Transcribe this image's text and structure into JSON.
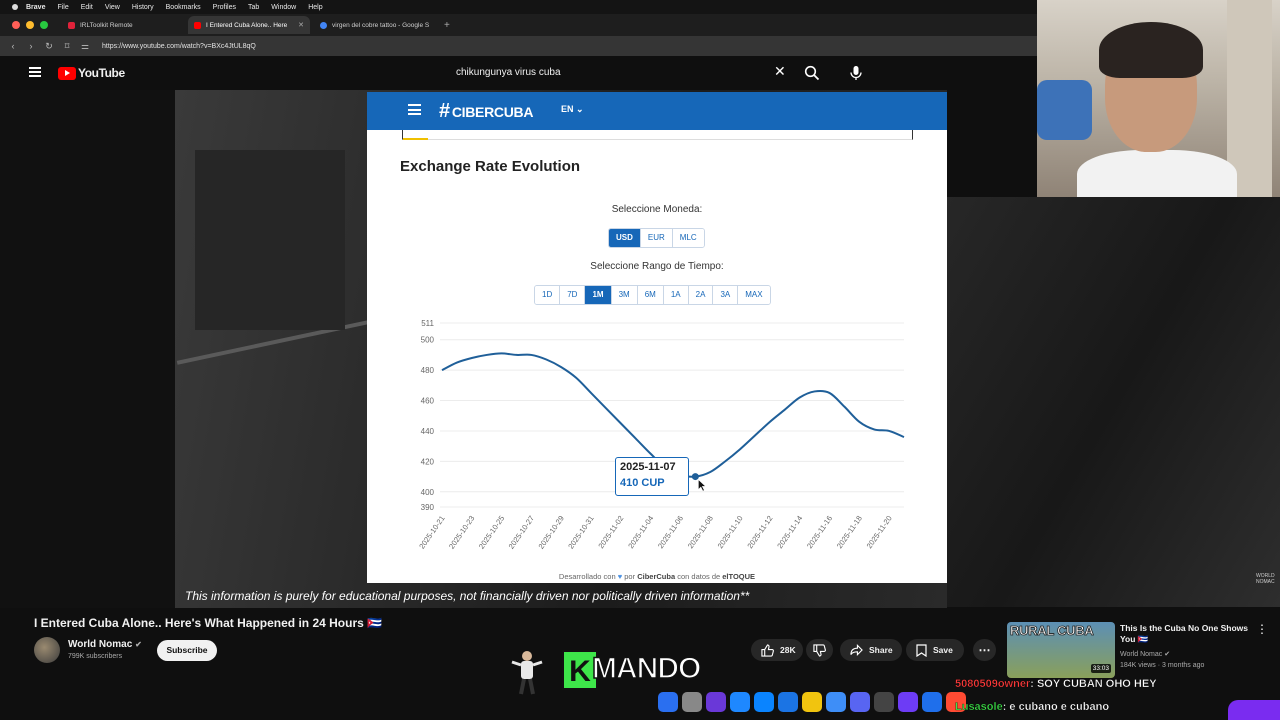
{
  "menubar": {
    "items": [
      "Brave",
      "File",
      "Edit",
      "View",
      "History",
      "Bookmarks",
      "Profiles",
      "Tab",
      "Window",
      "Help"
    ]
  },
  "tabs": [
    {
      "label": "IRLToolkit Remote",
      "color": "#e0223a"
    },
    {
      "label": "I Entered Cuba Alone.. Here",
      "color": "#ff0000"
    },
    {
      "label": "virgen del cobre tattoo - Google S",
      "color": "#4285f4"
    }
  ],
  "address": {
    "url": "https://www.youtube.com/watch?v=BXc4JtUL8qQ"
  },
  "youtube": {
    "logo_text": "YouTube",
    "search_query": "chikungunya virus cuba"
  },
  "phone_page": {
    "brand": "CIBERCUBA",
    "lang": "EN",
    "heading": "Exchange Rate Evolution",
    "currency_label": "Seleccione Moneda:",
    "currencies": [
      "USD",
      "EUR",
      "MLC"
    ],
    "selected_currency": "USD",
    "range_label": "Seleccione Rango de Tiempo:",
    "ranges": [
      "1D",
      "7D",
      "1M",
      "3M",
      "6M",
      "1A",
      "2A",
      "3A",
      "MAX"
    ],
    "selected_range": "1M",
    "footer_pre": "Desarrollado con",
    "footer_mid": "por",
    "footer_brand": "CiberCuba",
    "footer_with": "con datos de",
    "footer_source": "elTOQUE",
    "tooltip": {
      "date": "2025-11-07",
      "value": "410 CUP"
    }
  },
  "chart_data": {
    "type": "line",
    "title": "Exchange Rate Evolution",
    "xlabel": "",
    "ylabel": "",
    "ylim": [
      390,
      511
    ],
    "yticks": [
      "511",
      "500",
      "480",
      "460",
      "440",
      "420",
      "400",
      "390"
    ],
    "xticks": [
      "2025-10-21",
      "2025-10-23",
      "2025-10-25",
      "2025-10-27",
      "2025-10-29",
      "2025-10-31",
      "2025-11-02",
      "2025-11-04",
      "2025-11-06",
      "2025-11-08",
      "2025-11-10",
      "2025-11-12",
      "2025-11-14",
      "2025-11-16",
      "2025-11-18",
      "2025-11-20"
    ],
    "grid": true,
    "color": "#1f5f99",
    "series": [
      {
        "x": [
          "2025-10-21",
          "2025-10-22",
          "2025-10-23",
          "2025-10-24",
          "2025-10-25",
          "2025-10-26",
          "2025-10-27",
          "2025-10-28",
          "2025-10-29",
          "2025-10-30",
          "2025-10-31",
          "2025-11-01",
          "2025-11-02",
          "2025-11-03",
          "2025-11-04",
          "2025-11-05",
          "2025-11-06",
          "2025-11-07",
          "2025-11-08",
          "2025-11-09",
          "2025-11-10",
          "2025-11-11",
          "2025-11-12",
          "2025-11-13",
          "2025-11-14",
          "2025-11-15",
          "2025-11-16",
          "2025-11-17",
          "2025-11-18",
          "2025-11-19",
          "2025-11-20",
          "2025-11-21"
        ],
        "values": [
          480,
          485,
          488,
          490,
          491,
          490,
          490,
          487,
          482,
          475,
          465,
          455,
          445,
          435,
          425,
          416,
          411,
          410,
          413,
          420,
          428,
          437,
          446,
          454,
          462,
          466,
          465,
          456,
          446,
          441,
          440,
          436
        ]
      }
    ]
  },
  "video": {
    "subtitle": "This information is purely for educational purposes, not financially driven nor politically driven information**",
    "title": "I Entered Cuba Alone.. Here's What Happened in 24 Hours 🇨🇺",
    "channel": "World Nomac",
    "subscribers": "799K subscribers",
    "subscribe_label": "Subscribe",
    "likes": "28K",
    "share_label": "Share",
    "save_label": "Save"
  },
  "overlay": {
    "k": "K",
    "name": "MANDO"
  },
  "related": {
    "thumb_text": "RURAL CUBA",
    "duration": "33:03",
    "title": "This Is the Cuba No One Shows You 🇨🇺",
    "channel": "World Nomac",
    "meta": "184K views · 3 months ago"
  },
  "chat": [
    {
      "user": "5080509owner",
      "message": ": SOY CUBAN OHO HEY"
    },
    {
      "user": "Lusasole",
      "message": ": e cubano e cubano"
    }
  ],
  "watermark": "WORLD NOMAC",
  "dock_colors": [
    "#2a6ff0",
    "#888",
    "#6a38d8",
    "#1e88ff",
    "#0a84ff",
    "#1b74e4",
    "#f1c40f",
    "#3e8ef7",
    "#5865f2",
    "#444",
    "#6d3cf5",
    "#1f6feb",
    "#ff4b33"
  ]
}
